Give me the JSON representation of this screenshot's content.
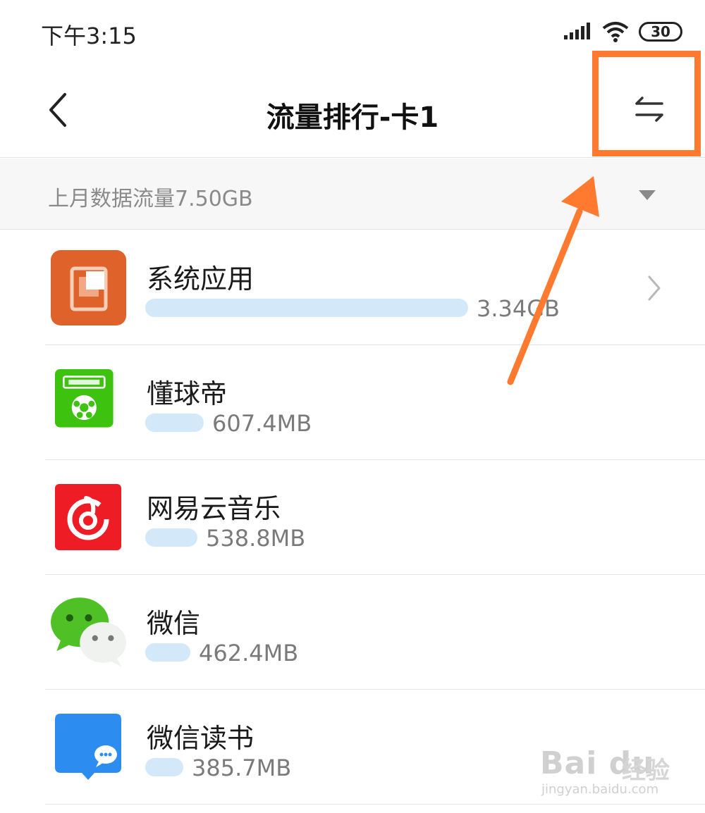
{
  "status_bar": {
    "time": "下午3:15",
    "battery": "30"
  },
  "header": {
    "title": "流量排行-卡1"
  },
  "summary": {
    "text": "上月数据流量7.50GB"
  },
  "apps": [
    {
      "name": "系统应用",
      "usage": "3.34GB",
      "bar_fraction": 0.445
    },
    {
      "name": "懂球帝",
      "usage": "607.4MB",
      "bar_fraction": 0.081
    },
    {
      "name": "网易云音乐",
      "usage": "538.8MB",
      "bar_fraction": 0.072
    },
    {
      "name": "微信",
      "usage": "462.4MB",
      "bar_fraction": 0.062
    },
    {
      "name": "微信读书",
      "usage": "385.7MB",
      "bar_fraction": 0.052
    }
  ],
  "icons": {
    "back": "back-icon",
    "switch": "swap-arrows-icon",
    "dropdown": "triangle-down-icon",
    "chevron": "chevron-right-icon"
  },
  "colors": {
    "accent_orange": "#ff7a2e",
    "usage_bar": "#d3e9fa",
    "summary_bg": "#f7f7f7"
  },
  "watermark": {
    "logo": "Bai du",
    "cn": "经验",
    "url": "jingyan.baidu.com"
  }
}
